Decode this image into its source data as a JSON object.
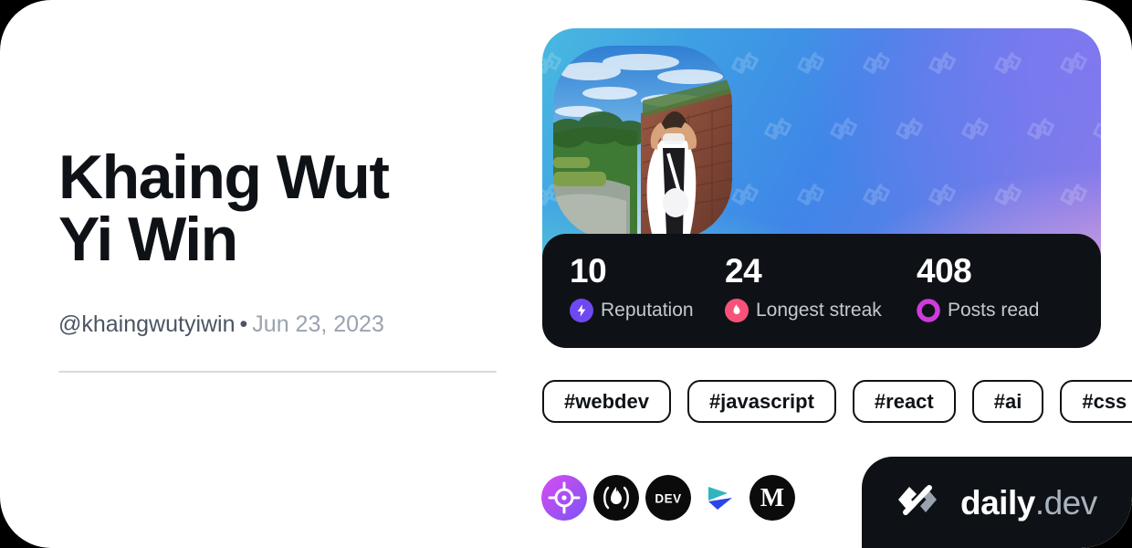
{
  "profile": {
    "name": "Khaing Wut\nYi Win",
    "handle": "@khaingwutyiwin",
    "separator": "•",
    "date": "Jun 23, 2023",
    "avatar_alt": "profile-photo"
  },
  "stats": [
    {
      "value": "10",
      "label": "Reputation",
      "icon": "bolt-icon",
      "color": "#6e49f2"
    },
    {
      "value": "24",
      "label": "Longest streak",
      "icon": "flame-icon",
      "color": "#f8527a"
    },
    {
      "value": "408",
      "label": "Posts read",
      "icon": "ring-icon",
      "color": "#cf3bdb"
    }
  ],
  "tags": [
    {
      "label": "#webdev"
    },
    {
      "label": "#javascript"
    },
    {
      "label": "#react"
    },
    {
      "label": "#ai"
    },
    {
      "label": "#css"
    }
  ],
  "socials": [
    {
      "name": "roadmap-icon"
    },
    {
      "name": "hashnode-flame-icon"
    },
    {
      "name": "devto-icon",
      "label": "DEV"
    },
    {
      "name": "bluesky-icon"
    },
    {
      "name": "medium-icon",
      "label": "M"
    }
  ],
  "brand": {
    "logo": "daily-dev-logo-icon",
    "name": "daily",
    "suffix": ".dev"
  },
  "colors": {
    "card_bg": "#ffffff",
    "text_primary": "#0e1217",
    "text_muted": "#4b5563",
    "text_faint": "#9aa3af",
    "dark_panel": "#0e1217"
  }
}
